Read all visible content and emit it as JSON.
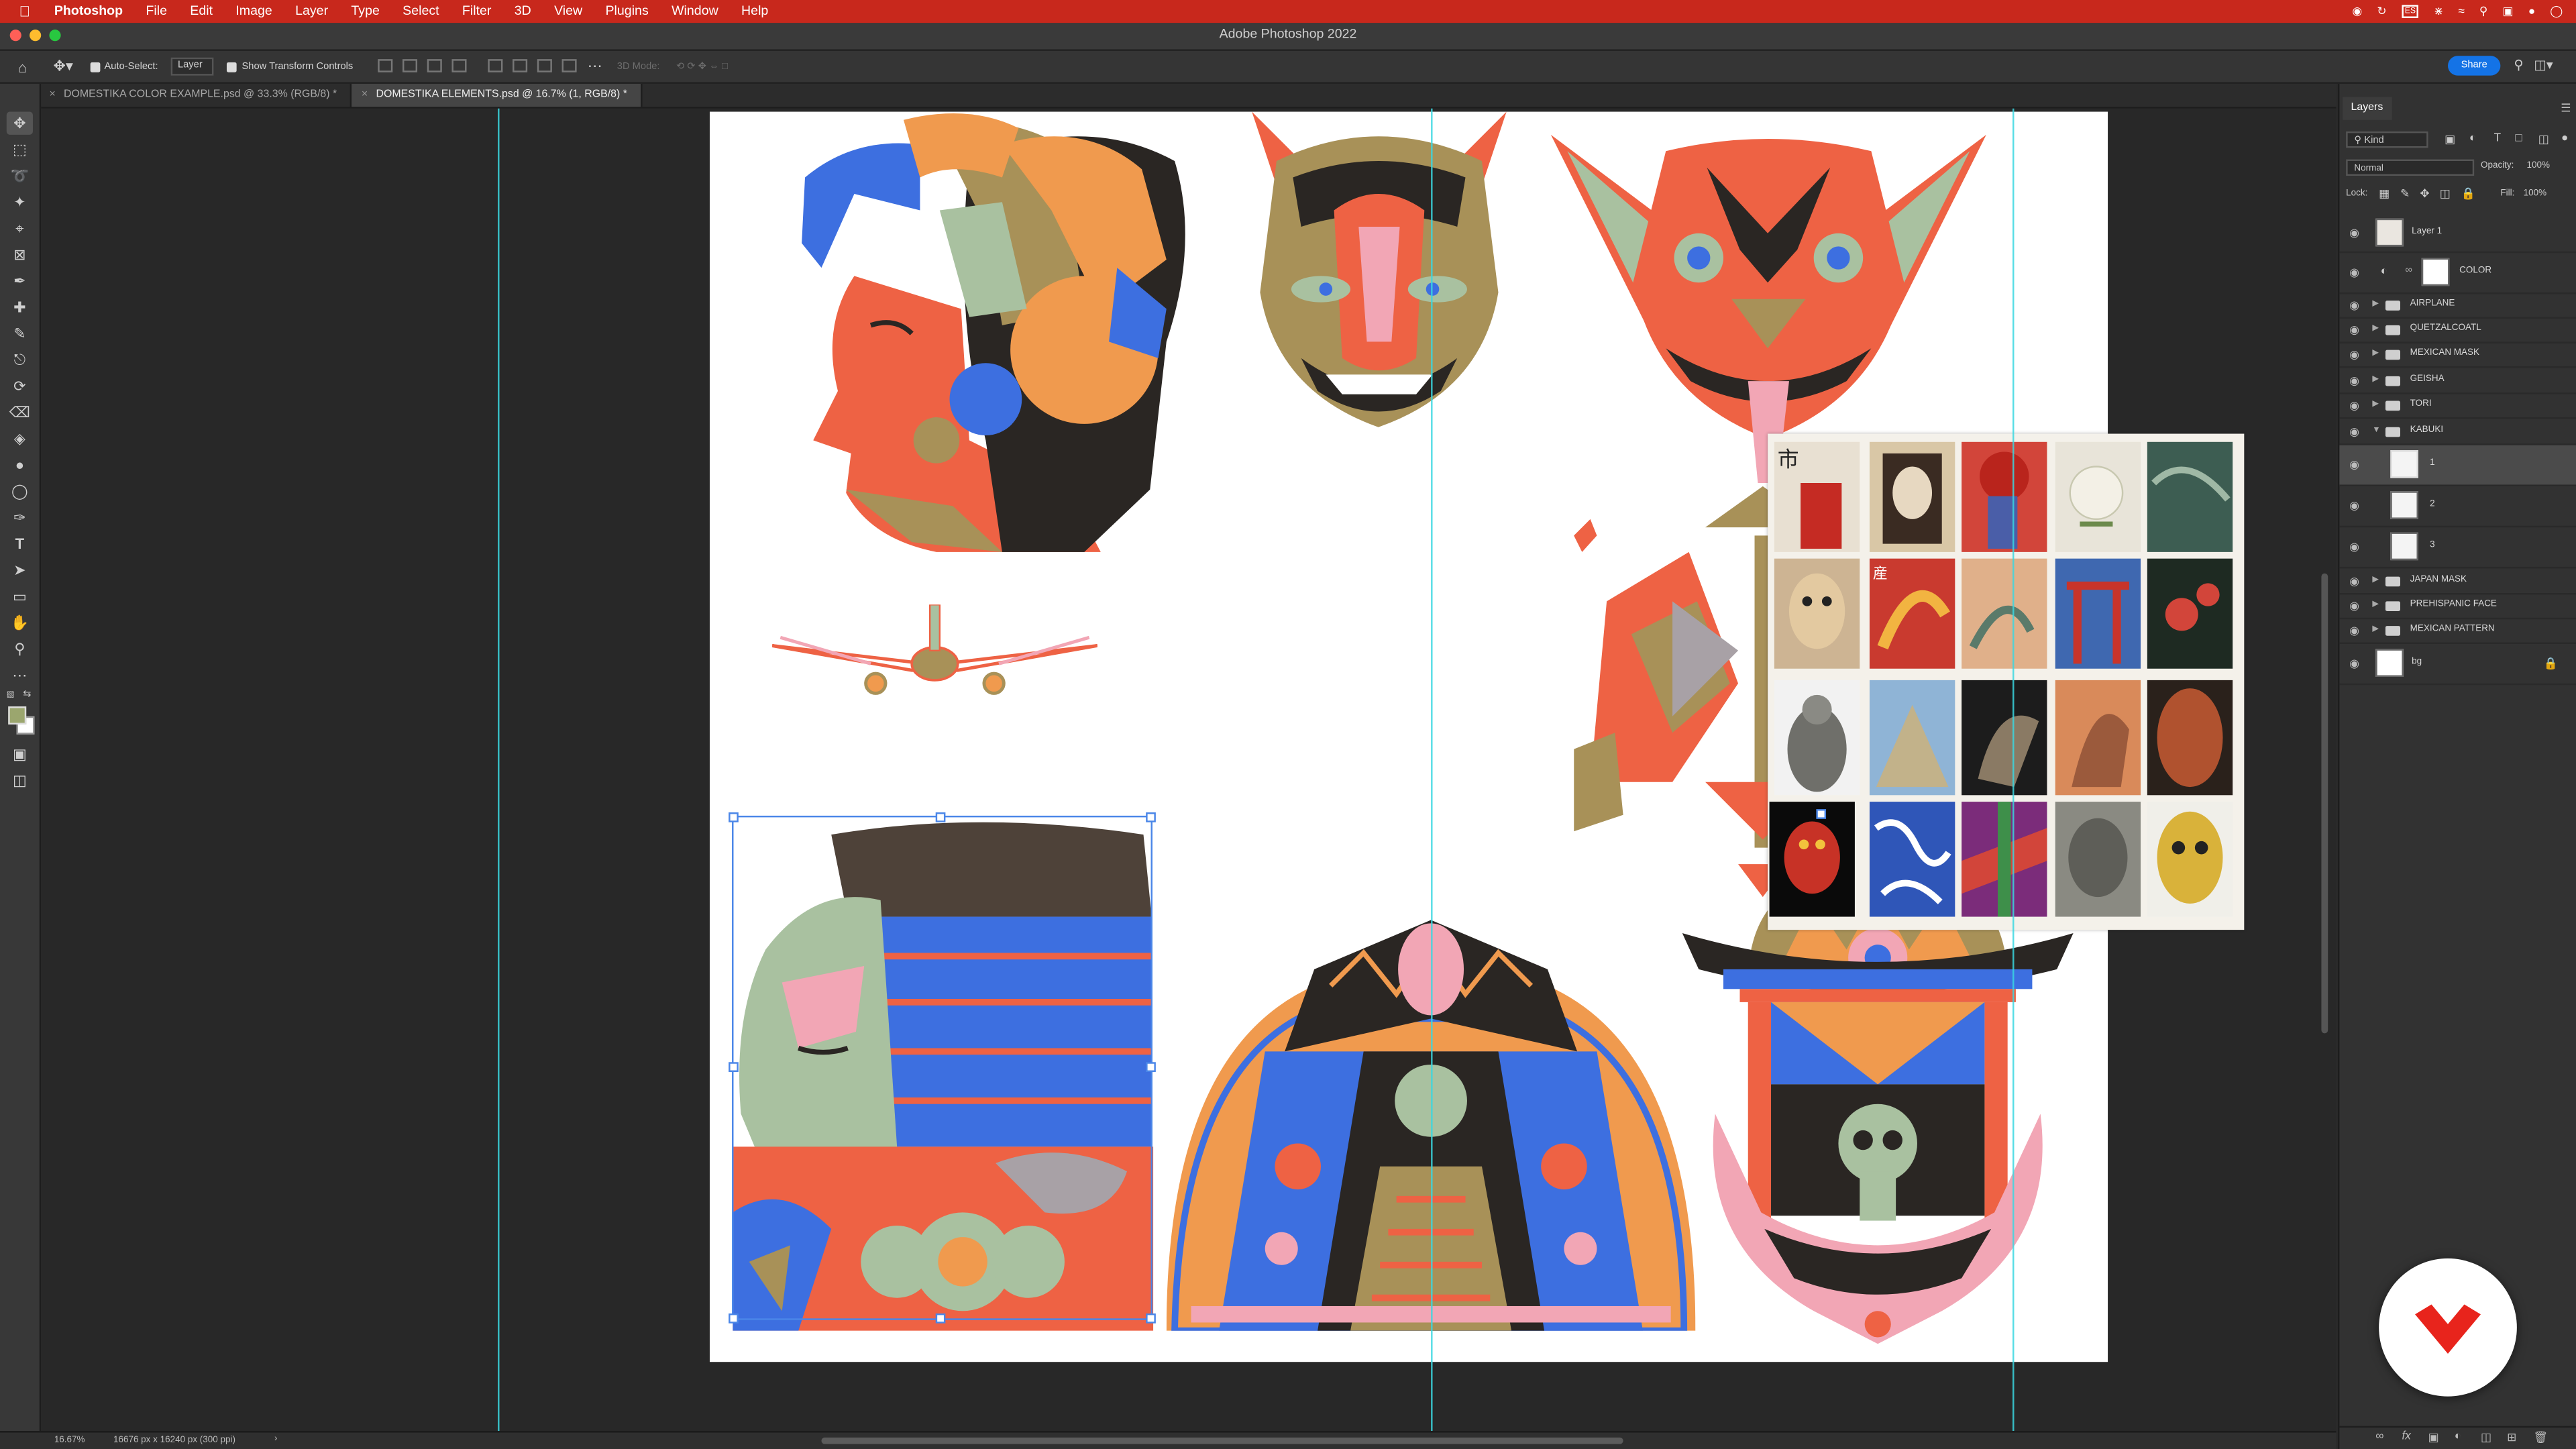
{
  "menubar": {
    "app_name": "Photoshop",
    "items": [
      "File",
      "Edit",
      "Image",
      "Layer",
      "Type",
      "Select",
      "Filter",
      "3D",
      "View",
      "Plugins",
      "Window",
      "Help"
    ],
    "input_source": "ES"
  },
  "window": {
    "title": "Adobe Photoshop 2022"
  },
  "options_bar": {
    "auto_select_label": "Auto-Select:",
    "auto_select_value": "Layer",
    "show_transform_label": "Show Transform Controls",
    "mode_3d_label": "3D Mode:",
    "share_label": "Share"
  },
  "tabs": [
    {
      "label": "DOMESTIKA COLOR EXAMPLE.psd @ 33.3% (RGB/8) *",
      "active": false
    },
    {
      "label": "DOMESTIKA ELEMENTS.psd @ 16.7% (1, RGB/8) *",
      "active": true
    }
  ],
  "status_bar": {
    "zoom": "16.67%",
    "dimensions": "16676 px x 16240 px (300 ppi)"
  },
  "layers_panel": {
    "title": "Layers",
    "filter_label": "Kind",
    "blend_mode": "Normal",
    "opacity_label": "Opacity:",
    "opacity_value": "100%",
    "lock_label": "Lock:",
    "fill_label": "Fill:",
    "fill_value": "100%",
    "layers": [
      {
        "name": "Layer 1",
        "type": "pixel"
      },
      {
        "name": "COLOR",
        "type": "adjustment"
      },
      {
        "name": "AIRPLANE",
        "type": "group"
      },
      {
        "name": "QUETZALCOATL",
        "type": "group"
      },
      {
        "name": "MEXICAN MASK",
        "type": "group"
      },
      {
        "name": "GEISHA",
        "type": "group"
      },
      {
        "name": "TORI",
        "type": "group"
      },
      {
        "name": "KABUKI",
        "type": "group-open"
      },
      {
        "name": "1",
        "type": "child",
        "selected": true
      },
      {
        "name": "2",
        "type": "child"
      },
      {
        "name": "3",
        "type": "child"
      },
      {
        "name": "JAPAN MASK",
        "type": "group"
      },
      {
        "name": "PREHISPANIC FACE",
        "type": "group"
      },
      {
        "name": "MEXICAN PATTERN",
        "type": "group"
      },
      {
        "name": "bg",
        "type": "background"
      }
    ]
  },
  "colors": {
    "menubar": "#c8281c",
    "accent": "#1473e6",
    "guide": "#39d7e0",
    "art_orange": "#ee6244",
    "art_blue": "#3d6fe0",
    "art_olive": "#a89158",
    "art_sage": "#a9c1a0",
    "art_pink": "#f2a6b5",
    "art_dark": "#2a2623"
  }
}
